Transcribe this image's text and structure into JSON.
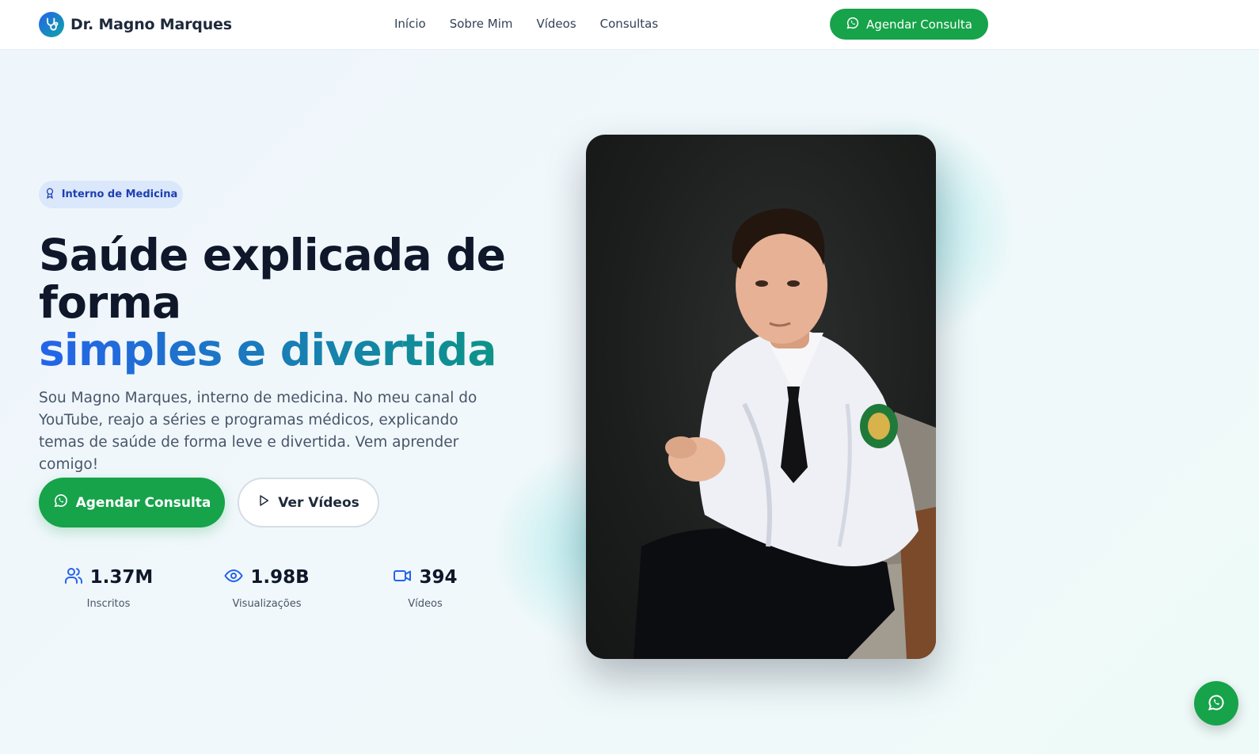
{
  "header": {
    "brand_name": "Dr. Magno Marques",
    "nav": [
      "Início",
      "Sobre Mim",
      "Vídeos",
      "Consultas"
    ],
    "cta_label": "Agendar Consulta"
  },
  "hero": {
    "badge": "Interno de Medicina",
    "title_line1": "Saúde explicada de forma",
    "title_highlight": "simples e divertida",
    "description": "Sou Magno Marques, interno de medicina. No meu canal do YouTube, reajo a séries e programas médicos, explicando temas de saúde de forma leve e divertida. Vem aprender comigo!",
    "primary_button": "Agendar Consulta",
    "secondary_button": "Ver Vídeos"
  },
  "stats": [
    {
      "icon": "users-icon",
      "value": "1.37M",
      "label": "Inscritos"
    },
    {
      "icon": "eye-icon",
      "value": "1.98B",
      "label": "Visualizações"
    },
    {
      "icon": "video-icon",
      "value": "394",
      "label": "Vídeos"
    }
  ],
  "colors": {
    "brand_green": "#16a34a",
    "accent_blue": "#2563eb",
    "accent_teal": "#0d9488",
    "dark_text": "#0f172a"
  }
}
